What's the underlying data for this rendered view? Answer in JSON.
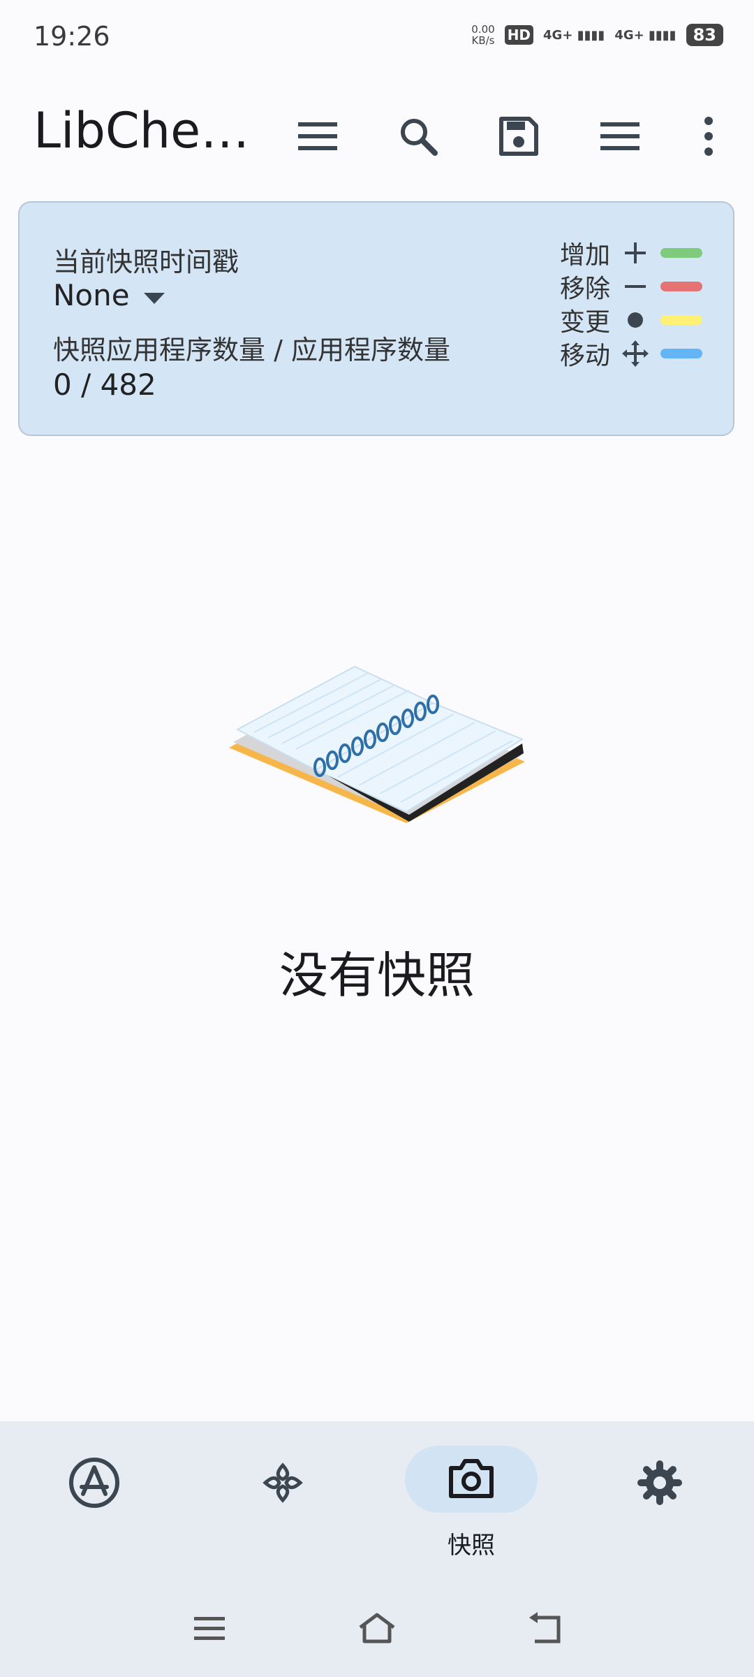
{
  "status_bar": {
    "time": "19:26",
    "net_speed_value": "0.00",
    "net_speed_unit": "KB/s",
    "hd_badge": "HD",
    "sim1": "4G+",
    "sim2": "4G+",
    "battery": "83"
  },
  "app_bar": {
    "title": "LibChe…",
    "icons": [
      "menu-icon",
      "search-icon",
      "save-icon",
      "list-icon",
      "more-vert-icon"
    ]
  },
  "snapshot_card": {
    "timestamp_label": "当前快照时间戳",
    "timestamp_value": "None",
    "count_label": "快照应用程序数量 / 应用程序数量",
    "count_value": "0 / 482",
    "legend": [
      {
        "label": "增加",
        "symbol": "plus",
        "color": "#7ecb7e"
      },
      {
        "label": "移除",
        "symbol": "minus",
        "color": "#e57373"
      },
      {
        "label": "变更",
        "symbol": "dot",
        "color": "#fff176"
      },
      {
        "label": "移动",
        "symbol": "move",
        "color": "#64b5f6"
      }
    ]
  },
  "empty_state": {
    "text": "没有快照"
  },
  "bottom_nav": {
    "items": [
      {
        "icon": "app-store-icon",
        "label": "",
        "selected": false
      },
      {
        "icon": "library-icon",
        "label": "",
        "selected": false
      },
      {
        "icon": "camera-icon",
        "label": "快照",
        "selected": true
      },
      {
        "icon": "settings-icon",
        "label": "",
        "selected": false
      }
    ]
  },
  "system_nav": [
    "recents-icon",
    "home-icon",
    "back-icon"
  ],
  "colors": {
    "card_bg": "#d4e5f6",
    "nav_bg": "#e6ecf2",
    "nav_indicator": "#d2e3f3",
    "icon": "#3c4650"
  }
}
